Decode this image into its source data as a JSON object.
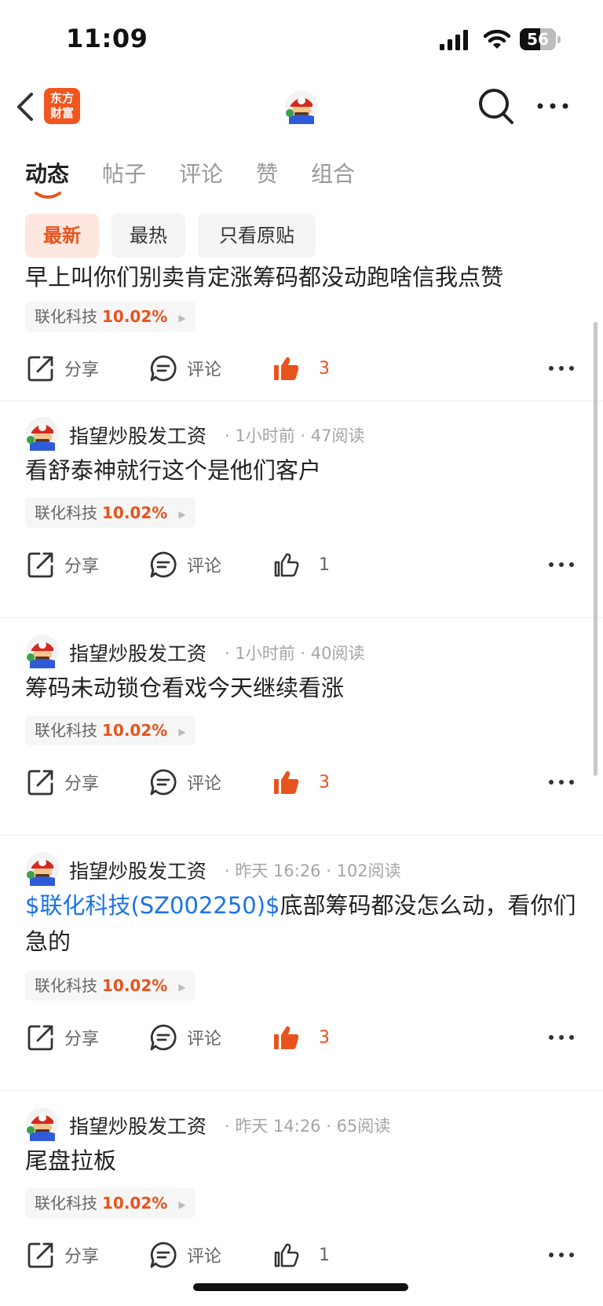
{
  "status": {
    "time": "11:09",
    "battery": "56",
    "battery_level": 0.56,
    "icons": [
      "signal-icon",
      "wifi-icon",
      "battery-icon"
    ]
  },
  "nav": {
    "logo_line1": "东方",
    "logo_line2": "财富",
    "icons": [
      "back-icon",
      "avatar-icon",
      "search-icon",
      "more-icon"
    ]
  },
  "tabs": [
    {
      "label": "动态",
      "active": true
    },
    {
      "label": "帖子",
      "active": false
    },
    {
      "label": "评论",
      "active": false
    },
    {
      "label": "赞",
      "active": false
    },
    {
      "label": "组合",
      "active": false
    }
  ],
  "filters": [
    {
      "label": "最新",
      "active": true
    },
    {
      "label": "最热",
      "active": false
    },
    {
      "label": "只看原贴",
      "active": false
    }
  ],
  "actions": {
    "share": "分享",
    "comment": "评论"
  },
  "posts": [
    {
      "user": "",
      "meta": "",
      "text": "早上叫你们别卖肯定涨筹码都没动跑啥信我点赞",
      "tag": "",
      "stock": "联化科技",
      "change": "10.02%",
      "likes": "3",
      "liked": true
    },
    {
      "user": "指望炒股发工资",
      "meta": "· 1小时前 · 47阅读",
      "text": "看舒泰神就行这个是他们客户",
      "tag": "",
      "stock": "联化科技",
      "change": "10.02%",
      "likes": "1",
      "liked": false
    },
    {
      "user": "指望炒股发工资",
      "meta": "· 1小时前 · 40阅读",
      "text": "筹码未动锁仓看戏今天继续看涨",
      "tag": "",
      "stock": "联化科技",
      "change": "10.02%",
      "likes": "3",
      "liked": true
    },
    {
      "user": "指望炒股发工资",
      "meta": "· 昨天 16:26 · 102阅读",
      "text": "底部筹码都没怎么动，看你们急的",
      "tag": "$联化科技(SZ002250)$",
      "stock": "联化科技",
      "change": "10.02%",
      "likes": "3",
      "liked": true
    },
    {
      "user": "指望炒股发工资",
      "meta": "· 昨天 14:26 · 65阅读",
      "text": "尾盘拉板",
      "tag": "",
      "stock": "联化科技",
      "change": "10.02%",
      "likes": "1",
      "liked": false
    }
  ],
  "colors": {
    "accent": "#e8531d",
    "link": "#1a73e8",
    "logo": "#f0561d"
  }
}
